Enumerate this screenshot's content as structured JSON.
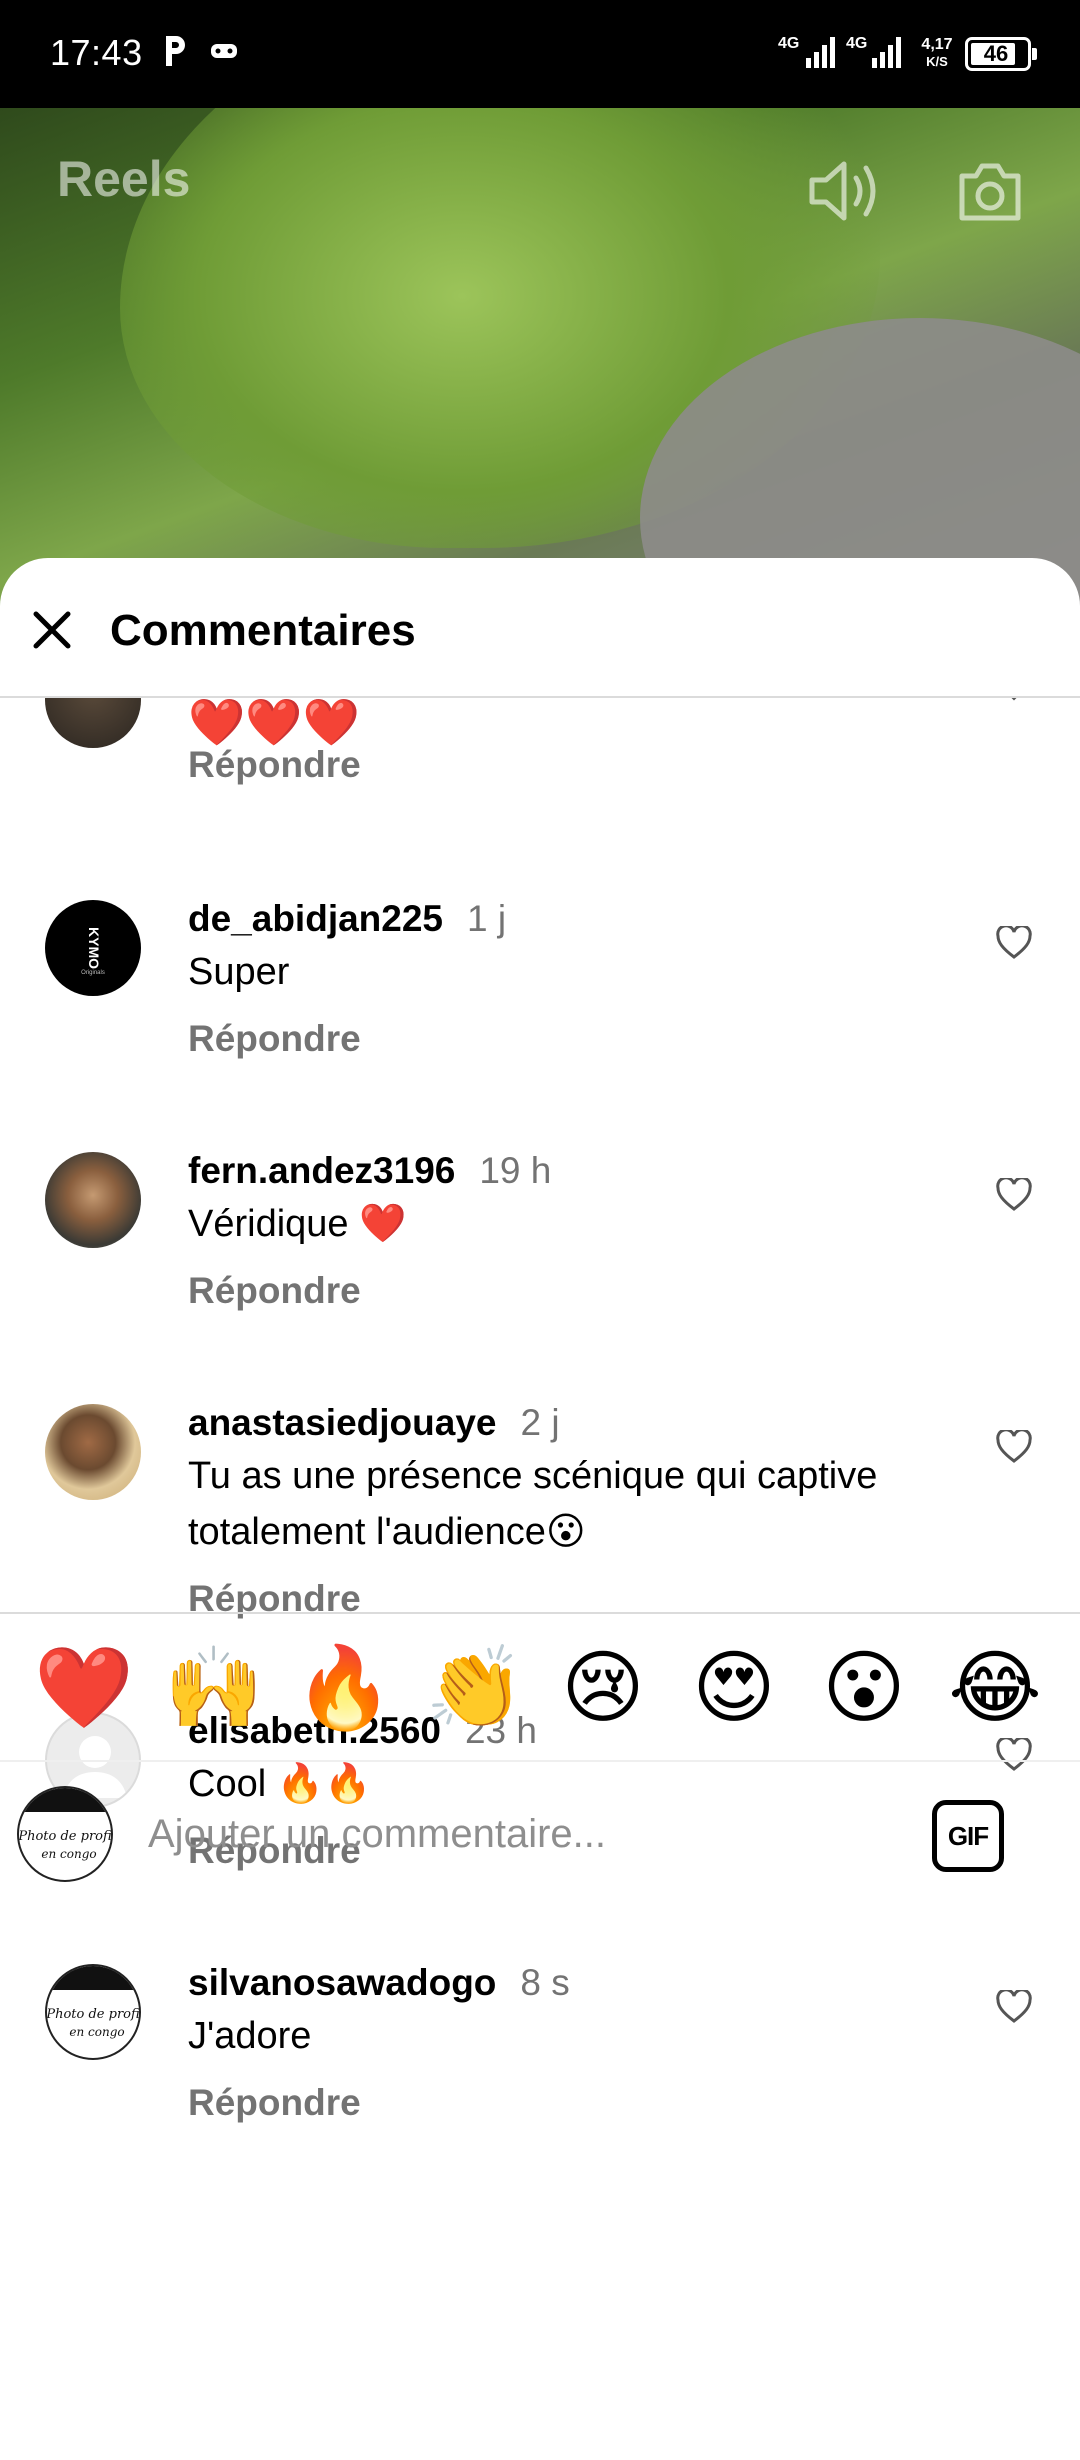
{
  "status_bar": {
    "time": "17:43",
    "network_1": "4G",
    "network_2": "4G",
    "speed_value": "4,17",
    "speed_unit": "K/S",
    "battery": "46"
  },
  "video": {
    "title": "Reels"
  },
  "sheet": {
    "title": "Commentaires"
  },
  "comments": [
    {
      "username": "",
      "time": "",
      "text": "❤️❤️❤️",
      "reply_label": "Répondre",
      "avatar": "partial-avatar"
    },
    {
      "username": "de_abidjan225",
      "time": "1 j",
      "text": "Super",
      "reply_label": "Répondre",
      "avatar": "kymo-logo-avatar"
    },
    {
      "username": "fern.andez3196",
      "time": "19 h",
      "text": "Véridique ❤️",
      "reply_label": "Répondre",
      "avatar": "man-photo-avatar"
    },
    {
      "username": "anastasiedjouaye",
      "time": "2 j",
      "text": "Tu as une présence scénique qui captive totalement l'audience😮",
      "reply_label": "Répondre",
      "avatar": "man-sunglasses-avatar"
    },
    {
      "username": "elisabeth.2560",
      "time": "23 h",
      "text": "Cool 🔥🔥",
      "reply_label": "Répondre",
      "avatar": "default-avatar"
    },
    {
      "username": "silvanosawadogo",
      "time": "8 s",
      "text": "J'adore",
      "reply_label": "Répondre",
      "avatar": "photo-de-profil-avatar"
    }
  ],
  "emoji_bar": [
    "❤️",
    "🙌",
    "🔥",
    "👏",
    "😢",
    "😍",
    "😮",
    "😂"
  ],
  "composer": {
    "placeholder": "Ajouter un commentaire...",
    "gif_label": "GIF",
    "avatar_text_line1": "Photo de profi",
    "avatar_text_line2": "en congo"
  },
  "colors": {
    "secondary_text": "#737373",
    "divider": "#dbdbdb",
    "heart_red": "#ed1c24"
  }
}
